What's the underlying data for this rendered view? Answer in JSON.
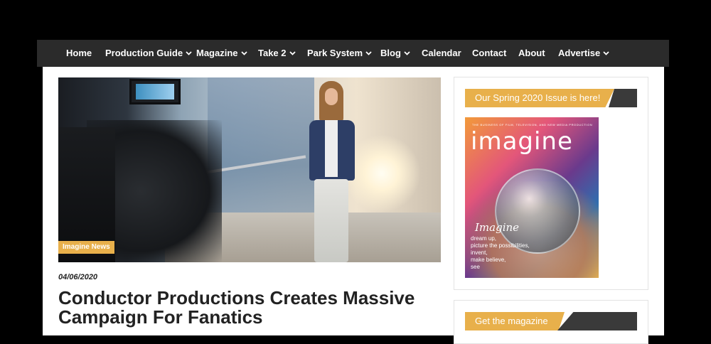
{
  "nav": {
    "items": [
      {
        "label": "Home",
        "dropdown": false
      },
      {
        "label": "Production Guide",
        "dropdown": true
      },
      {
        "label": "Magazine",
        "dropdown": true
      },
      {
        "label": "Take 2",
        "dropdown": true
      },
      {
        "label": "Park System",
        "dropdown": true
      },
      {
        "label": "Blog",
        "dropdown": true
      },
      {
        "label": "Calendar",
        "dropdown": false
      },
      {
        "label": "Contact",
        "dropdown": false
      },
      {
        "label": "About",
        "dropdown": false
      },
      {
        "label": "Advertise",
        "dropdown": true
      }
    ]
  },
  "post": {
    "category_badge": "Imagine News",
    "date": "04/06/2020",
    "title": "Conductor Productions Creates Massive Campaign For Fanatics"
  },
  "sidebar": {
    "widget1": {
      "heading": "Our Spring 2020 Issue is here!",
      "cover": {
        "tagline": "THE BUSINESS OF FILM, TELEVISION, AND NEW MEDIA PRODUCTION",
        "masthead": "imagine",
        "script_word": "Imagine",
        "lines": [
          "dream up,",
          "picture the possibilities,",
          "invent,",
          "make believe,",
          "see"
        ]
      }
    },
    "widget2": {
      "heading": "Get the magazine"
    }
  },
  "colors": {
    "accent_gold": "#e8b04b",
    "nav_bg": "#2b2b2b",
    "dark_tab": "#3a3a3a"
  },
  "icons": {
    "dropdown": "chevron-down-icon"
  }
}
